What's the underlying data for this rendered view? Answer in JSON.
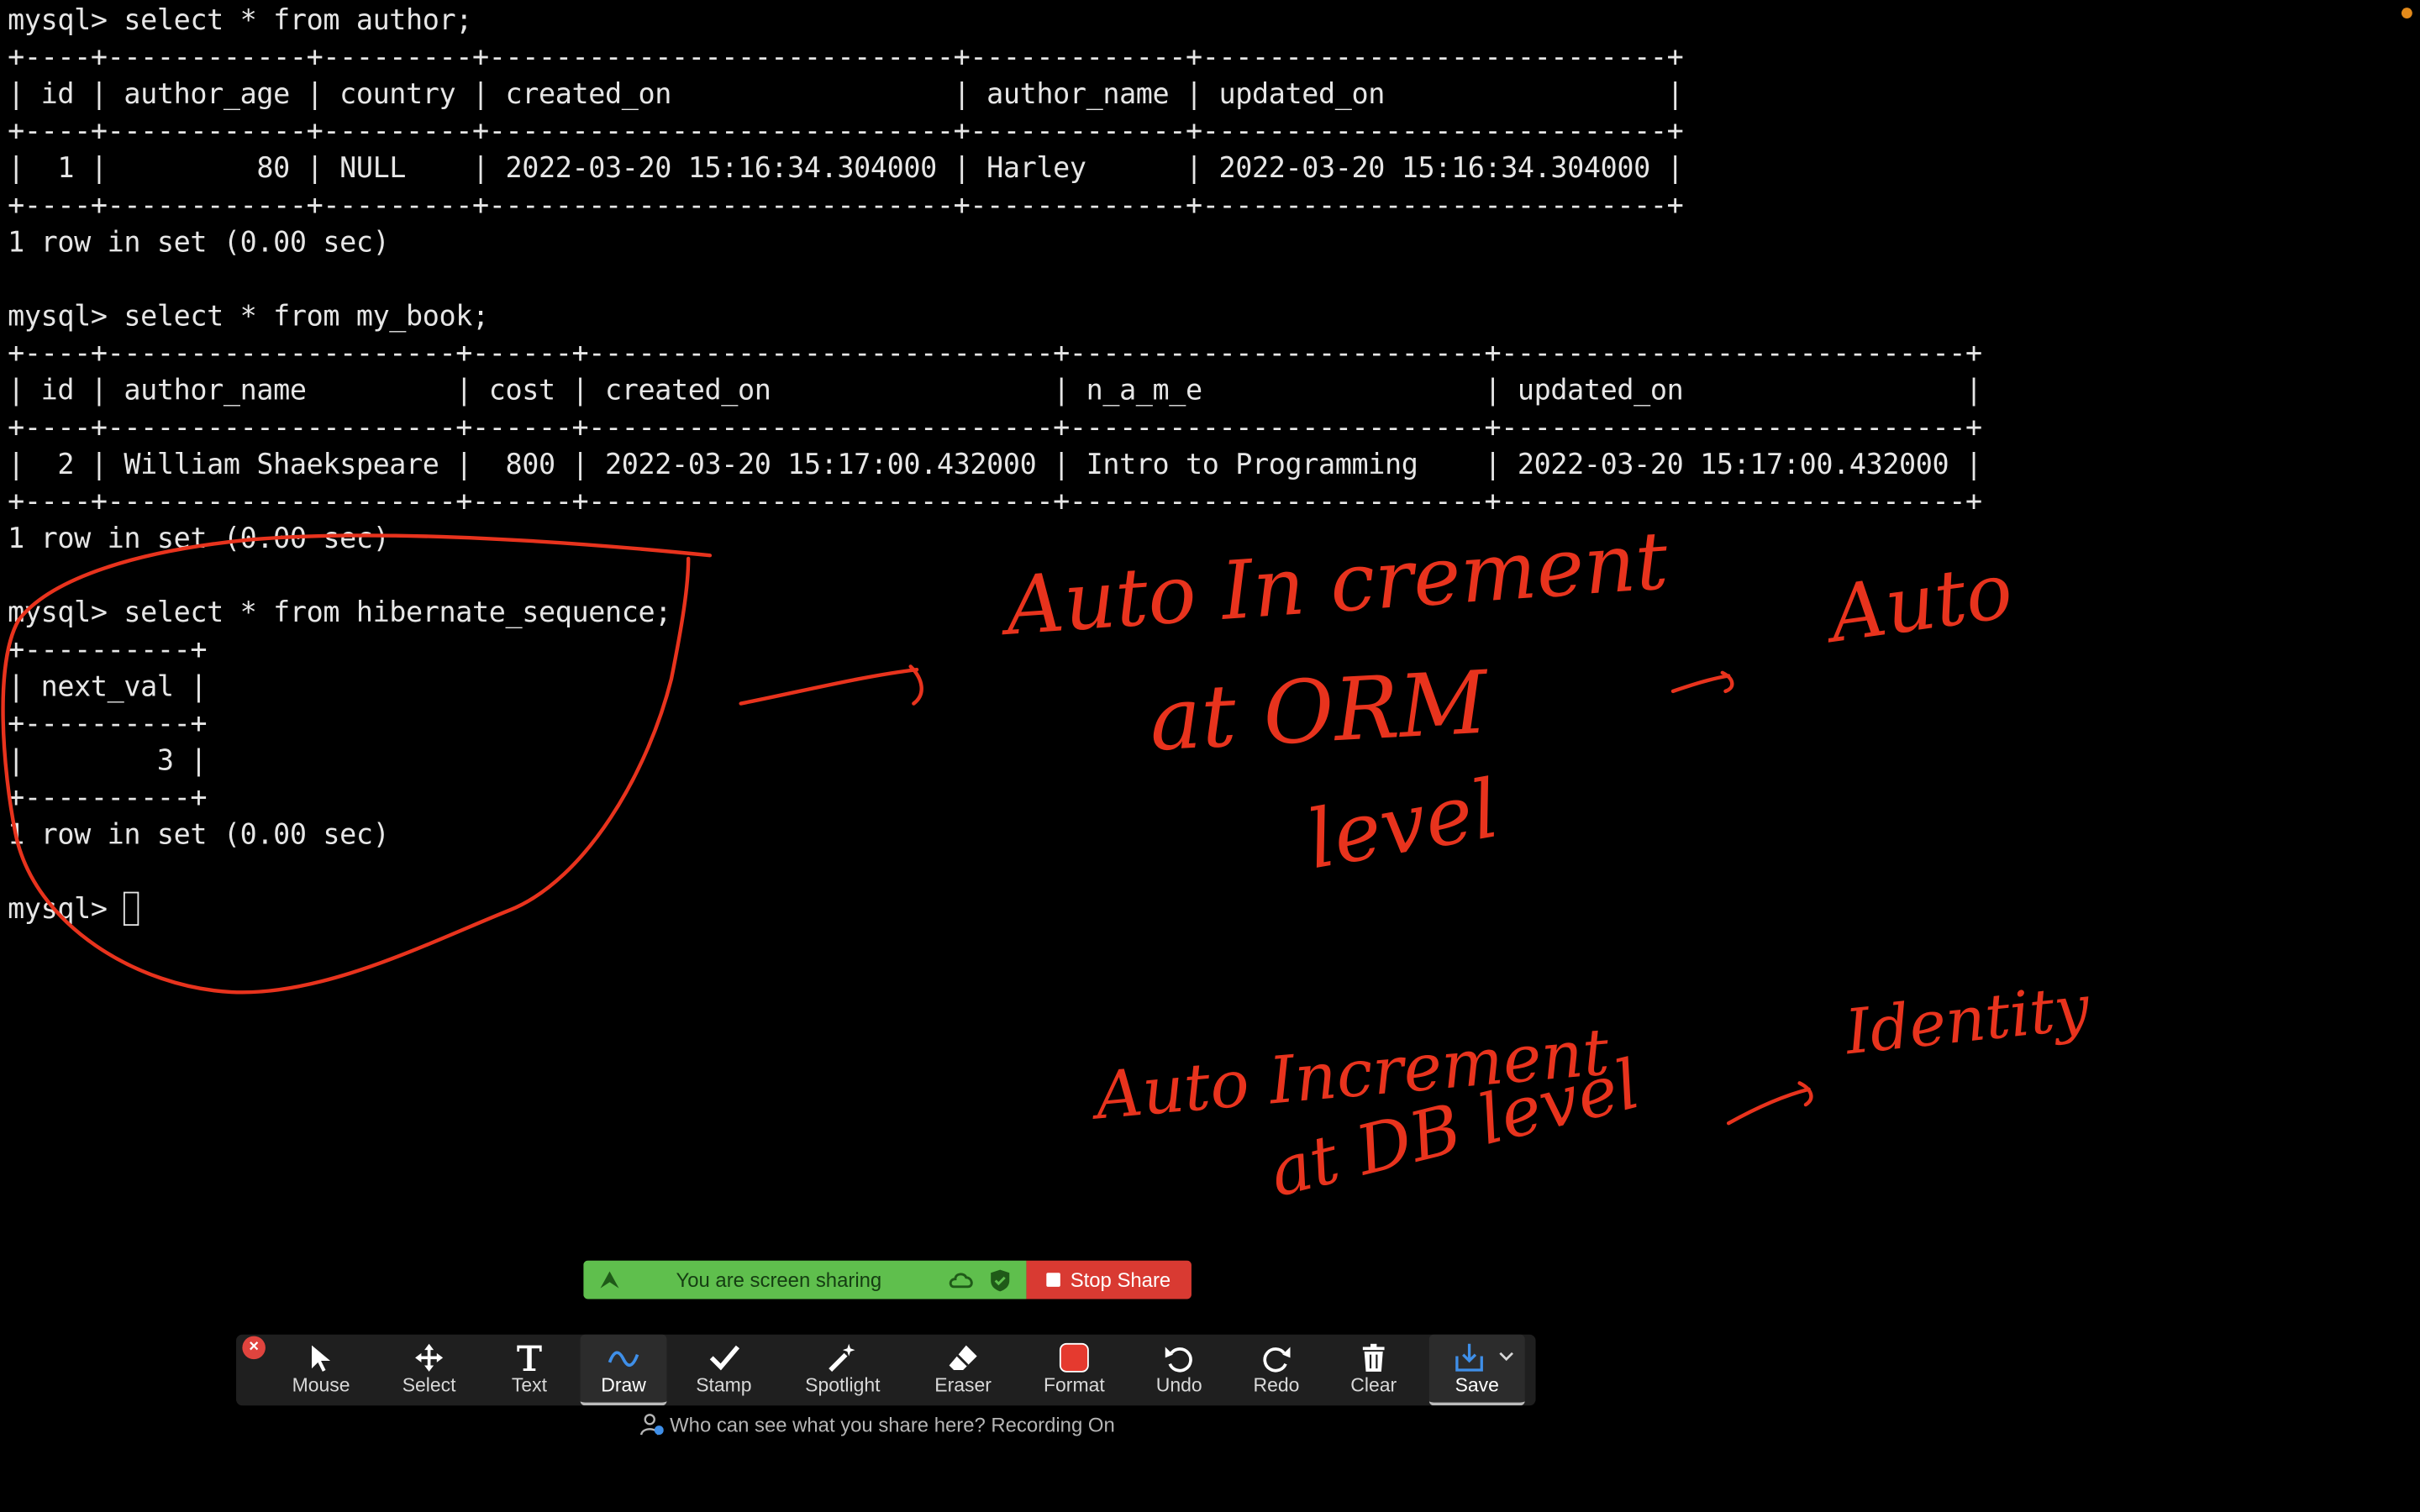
{
  "terminal": {
    "lines": [
      "mysql> select * from author;",
      "+----+------------+---------+----------------------------+-------------+----------------------------+",
      "| id | author_age | country | created_on                 | author_name | updated_on                 |",
      "+----+------------+---------+----------------------------+-------------+----------------------------+",
      "|  1 |         80 | NULL    | 2022-03-20 15:16:34.304000 | Harley      | 2022-03-20 15:16:34.304000 |",
      "+----+------------+---------+----------------------------+-------------+----------------------------+",
      "1 row in set (0.00 sec)",
      "",
      "mysql> select * from my_book;",
      "+----+---------------------+------+----------------------------+-------------------------+----------------------------+",
      "| id | author_name         | cost | created_on                 | n_a_m_e                 | updated_on                 |",
      "+----+---------------------+------+----------------------------+-------------------------+----------------------------+",
      "|  2 | William Shaekspeare |  800 | 2022-03-20 15:17:00.432000 | Intro to Programming    | 2022-03-20 15:17:00.432000 |",
      "+----+---------------------+------+----------------------------+-------------------------+----------------------------+",
      "1 row in set (0.00 sec)",
      "",
      "mysql> select * from hibernate_sequence;",
      "+----------+",
      "| next_val |",
      "+----------+",
      "|        3 |",
      "+----------+",
      "1 row in set (0.00 sec)",
      ""
    ],
    "prompt": "mysql> "
  },
  "annotations": {
    "line1": "Auto In crement",
    "line2": "at ORM",
    "line3": "level",
    "side_right_top": "Auto",
    "line4": "Auto Increment",
    "line5": "at DB level",
    "side_right_bottom": "Identity",
    "ink_color": "#e8331d"
  },
  "share_banner": {
    "status": "You are screen sharing",
    "stop_label": "Stop Share"
  },
  "toolbar": {
    "tools": [
      {
        "label": "Mouse",
        "icon": "mouse-pointer-icon"
      },
      {
        "label": "Select",
        "icon": "move-arrows-icon"
      },
      {
        "label": "Text",
        "icon": "text-t-icon"
      },
      {
        "label": "Draw",
        "icon": "squiggle-draw-icon"
      },
      {
        "label": "Stamp",
        "icon": "checkmark-stamp-icon"
      },
      {
        "label": "Spotlight",
        "icon": "magic-wand-icon"
      },
      {
        "label": "Eraser",
        "icon": "eraser-icon"
      },
      {
        "label": "Format",
        "icon": "red-square-format-icon"
      },
      {
        "label": "Undo",
        "icon": "undo-icon"
      },
      {
        "label": "Redo",
        "icon": "redo-icon"
      },
      {
        "label": "Clear",
        "icon": "trash-icon"
      },
      {
        "label": "Save",
        "icon": "download-save-icon"
      }
    ],
    "footer": "Who can see what you share here? Recording On",
    "accent": "#5fbf4d",
    "stop_color": "#d93a32"
  }
}
